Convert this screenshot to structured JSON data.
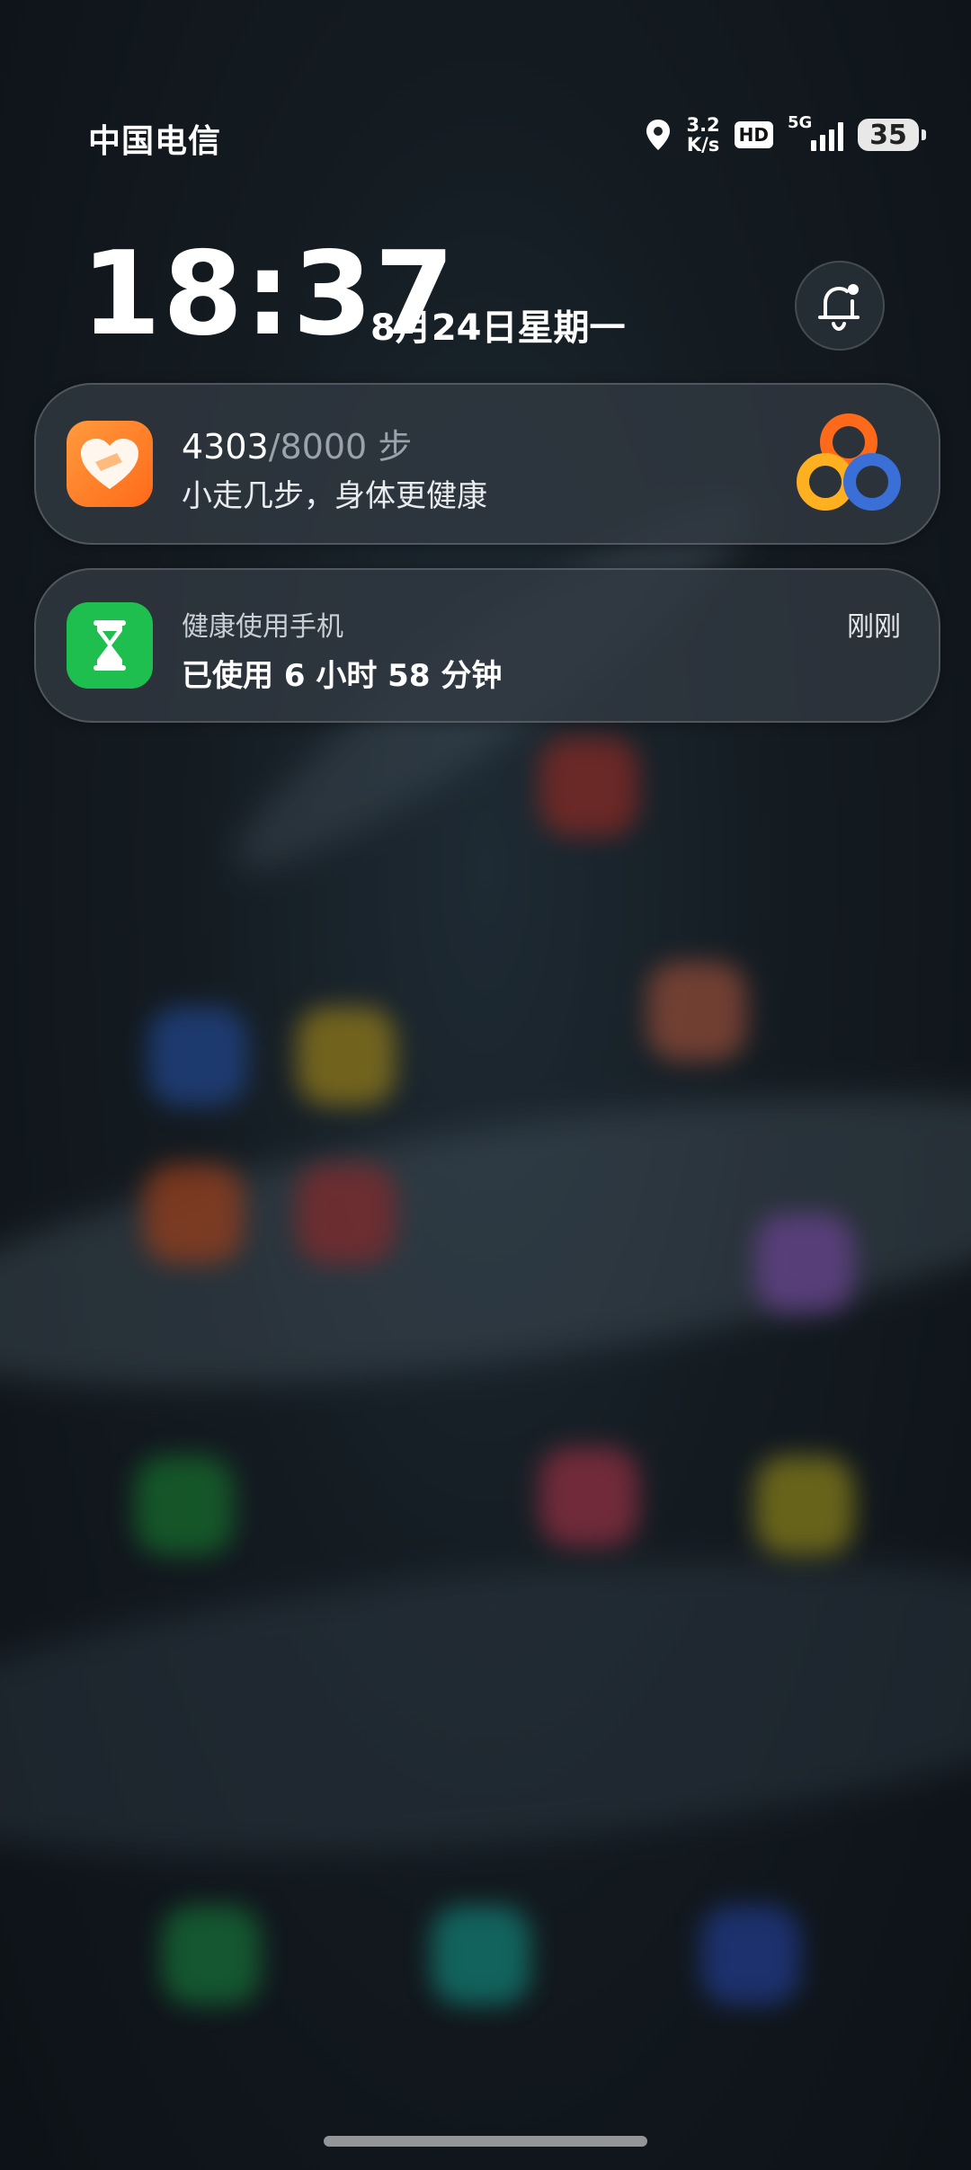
{
  "status_bar": {
    "carrier": "中国电信",
    "net_speed_value": "3.2",
    "net_speed_unit": "K/s",
    "hd_label": "HD",
    "network_type": "5G",
    "battery_level": "35",
    "icons": [
      "location-icon",
      "signal-icon",
      "battery-icon"
    ]
  },
  "lock_screen": {
    "time": "18:37",
    "date": "8月24日星期一",
    "bell_icon": "bell-icon"
  },
  "notifications": [
    {
      "app_icon": "health-heart-icon",
      "steps_current": "4303",
      "steps_separator": "/",
      "steps_goal": "8000",
      "steps_unit": " 步",
      "subtitle": "小走几步，身体更健康",
      "extra_icon": "activity-rings-icon"
    },
    {
      "app_icon": "hourglass-icon",
      "title": "健康使用手机",
      "body": "已使用 6 小时 58 分钟",
      "time": "刚刚"
    }
  ],
  "colors": {
    "steps_icon": "#ff7a22",
    "health_icon": "#1fbf4f",
    "ring_orange": "#ff6a1a",
    "ring_yellow": "#ffb020",
    "ring_blue": "#3b6fd8"
  }
}
